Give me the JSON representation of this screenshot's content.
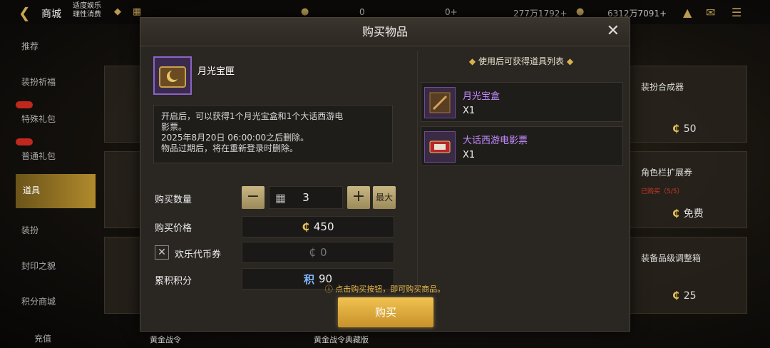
{
  "topbar": {
    "title": "商城",
    "notice_line1": "适度娱乐",
    "notice_line2": "理性消费",
    "currency_1": "0",
    "currency_2": "0+",
    "currency_3": "277万1792+",
    "currency_4": "6312万7091+"
  },
  "sidebar": {
    "items": [
      "推荐",
      "装扮祈福",
      "特殊礼包",
      "普通礼包",
      "道具",
      "装扮",
      "封印之貌",
      "积分商城",
      "充值"
    ]
  },
  "background_cards": {
    "card1": "装扮合成器",
    "card1_price": "50",
    "card2": "角色栏扩展券",
    "card2_sub": "已购买（5/5）",
    "card2_price": "免费",
    "card3": "装备品级调整箱",
    "card3_price": "25",
    "bottom1": "黄金战令",
    "bottom2": "黄金战令典藏版"
  },
  "modal": {
    "title": "购买物品",
    "item_name": "月光宝匣",
    "description": [
      "开启后，可以获得1个月光宝盒和1个大话西游电",
      "影票。",
      "2025年8月20日 06:00:00之后删除。",
      "物品过期后，将在重新登录时删除。"
    ],
    "qty_label": "购买数量",
    "qty_value": "3",
    "max_label": "最大",
    "price_label": "购买价格",
    "price_value": "450",
    "coupon_label": "欢乐代币券",
    "coupon_value": "0",
    "points_label": "累积积分",
    "points_icon": "积",
    "points_value": "90",
    "rewards_title": "使用后可获得道具列表",
    "rewards": [
      {
        "name": "月光宝盒",
        "qty": "X1"
      },
      {
        "name": "大话西游电影票",
        "qty": "X1"
      }
    ],
    "tip": "点击购买按钮，即可购买商品。",
    "buy_label": "购买"
  },
  "colors": {
    "accent_gold": "#e9b84a",
    "item_purple": "#c38cff",
    "buy_button": "#d9a53a"
  }
}
